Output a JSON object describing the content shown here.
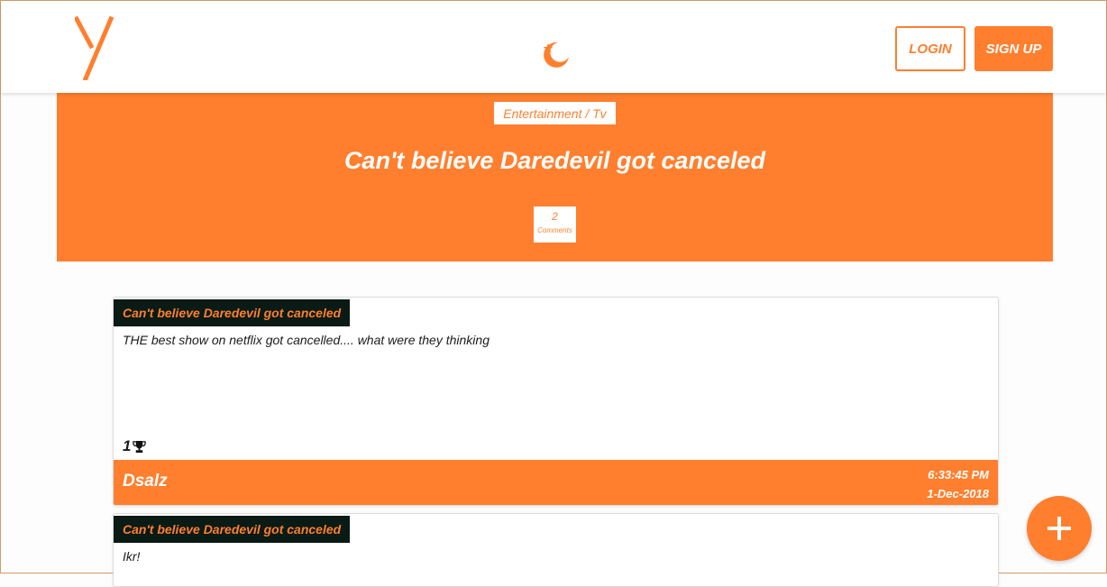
{
  "navbar": {
    "logo_icon": "y-logo-icon",
    "theme_icon": "moon-star-icon",
    "login_label": "LOGIN",
    "signup_label": "SIGN UP"
  },
  "hero": {
    "category": "Entertainment / Tv",
    "title": "Can't believe Daredevil got canceled",
    "comment_count": "2",
    "comment_label": "Comments"
  },
  "posts": [
    {
      "title": "Can't believe Daredevil got canceled",
      "body": "THE best show on netflix got cancelled.... what were they thinking",
      "likes": "1",
      "like_icon": "trophy-icon",
      "author": "Dsalz",
      "time": "6:33:45 PM",
      "date": "1-Dec-2018"
    },
    {
      "title": "Can't believe Daredevil got canceled",
      "body": "Ikr!"
    }
  ],
  "fab": {
    "icon": "plus-icon"
  },
  "colors": {
    "accent": "#ff7f2e",
    "dark": "#0a1a14",
    "white": "#ffffff"
  }
}
